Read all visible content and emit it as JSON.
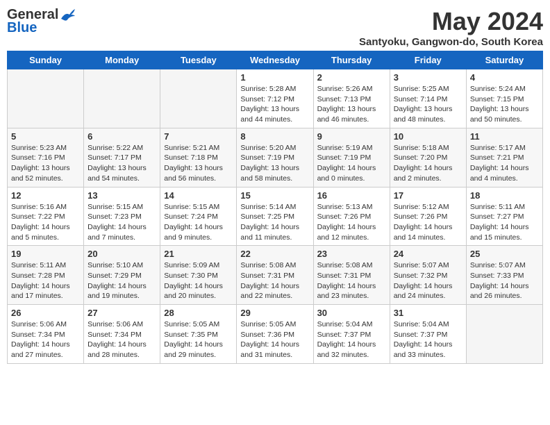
{
  "header": {
    "logo_general": "General",
    "logo_blue": "Blue",
    "month_year": "May 2024",
    "location": "Santyoku, Gangwon-do, South Korea"
  },
  "days_of_week": [
    "Sunday",
    "Monday",
    "Tuesday",
    "Wednesday",
    "Thursday",
    "Friday",
    "Saturday"
  ],
  "weeks": [
    [
      {
        "day": "",
        "empty": true
      },
      {
        "day": "",
        "empty": true
      },
      {
        "day": "",
        "empty": true
      },
      {
        "day": "1",
        "sunrise": "5:28 AM",
        "sunset": "7:12 PM",
        "daylight": "13 hours and 44 minutes."
      },
      {
        "day": "2",
        "sunrise": "5:26 AM",
        "sunset": "7:13 PM",
        "daylight": "13 hours and 46 minutes."
      },
      {
        "day": "3",
        "sunrise": "5:25 AM",
        "sunset": "7:14 PM",
        "daylight": "13 hours and 48 minutes."
      },
      {
        "day": "4",
        "sunrise": "5:24 AM",
        "sunset": "7:15 PM",
        "daylight": "13 hours and 50 minutes."
      }
    ],
    [
      {
        "day": "5",
        "sunrise": "5:23 AM",
        "sunset": "7:16 PM",
        "daylight": "13 hours and 52 minutes."
      },
      {
        "day": "6",
        "sunrise": "5:22 AM",
        "sunset": "7:17 PM",
        "daylight": "13 hours and 54 minutes."
      },
      {
        "day": "7",
        "sunrise": "5:21 AM",
        "sunset": "7:18 PM",
        "daylight": "13 hours and 56 minutes."
      },
      {
        "day": "8",
        "sunrise": "5:20 AM",
        "sunset": "7:19 PM",
        "daylight": "13 hours and 58 minutes."
      },
      {
        "day": "9",
        "sunrise": "5:19 AM",
        "sunset": "7:19 PM",
        "daylight": "14 hours and 0 minutes."
      },
      {
        "day": "10",
        "sunrise": "5:18 AM",
        "sunset": "7:20 PM",
        "daylight": "14 hours and 2 minutes."
      },
      {
        "day": "11",
        "sunrise": "5:17 AM",
        "sunset": "7:21 PM",
        "daylight": "14 hours and 4 minutes."
      }
    ],
    [
      {
        "day": "12",
        "sunrise": "5:16 AM",
        "sunset": "7:22 PM",
        "daylight": "14 hours and 5 minutes."
      },
      {
        "day": "13",
        "sunrise": "5:15 AM",
        "sunset": "7:23 PM",
        "daylight": "14 hours and 7 minutes."
      },
      {
        "day": "14",
        "sunrise": "5:15 AM",
        "sunset": "7:24 PM",
        "daylight": "14 hours and 9 minutes."
      },
      {
        "day": "15",
        "sunrise": "5:14 AM",
        "sunset": "7:25 PM",
        "daylight": "14 hours and 11 minutes."
      },
      {
        "day": "16",
        "sunrise": "5:13 AM",
        "sunset": "7:26 PM",
        "daylight": "14 hours and 12 minutes."
      },
      {
        "day": "17",
        "sunrise": "5:12 AM",
        "sunset": "7:26 PM",
        "daylight": "14 hours and 14 minutes."
      },
      {
        "day": "18",
        "sunrise": "5:11 AM",
        "sunset": "7:27 PM",
        "daylight": "14 hours and 15 minutes."
      }
    ],
    [
      {
        "day": "19",
        "sunrise": "5:11 AM",
        "sunset": "7:28 PM",
        "daylight": "14 hours and 17 minutes."
      },
      {
        "day": "20",
        "sunrise": "5:10 AM",
        "sunset": "7:29 PM",
        "daylight": "14 hours and 19 minutes."
      },
      {
        "day": "21",
        "sunrise": "5:09 AM",
        "sunset": "7:30 PM",
        "daylight": "14 hours and 20 minutes."
      },
      {
        "day": "22",
        "sunrise": "5:08 AM",
        "sunset": "7:31 PM",
        "daylight": "14 hours and 22 minutes."
      },
      {
        "day": "23",
        "sunrise": "5:08 AM",
        "sunset": "7:31 PM",
        "daylight": "14 hours and 23 minutes."
      },
      {
        "day": "24",
        "sunrise": "5:07 AM",
        "sunset": "7:32 PM",
        "daylight": "14 hours and 24 minutes."
      },
      {
        "day": "25",
        "sunrise": "5:07 AM",
        "sunset": "7:33 PM",
        "daylight": "14 hours and 26 minutes."
      }
    ],
    [
      {
        "day": "26",
        "sunrise": "5:06 AM",
        "sunset": "7:34 PM",
        "daylight": "14 hours and 27 minutes."
      },
      {
        "day": "27",
        "sunrise": "5:06 AM",
        "sunset": "7:34 PM",
        "daylight": "14 hours and 28 minutes."
      },
      {
        "day": "28",
        "sunrise": "5:05 AM",
        "sunset": "7:35 PM",
        "daylight": "14 hours and 29 minutes."
      },
      {
        "day": "29",
        "sunrise": "5:05 AM",
        "sunset": "7:36 PM",
        "daylight": "14 hours and 31 minutes."
      },
      {
        "day": "30",
        "sunrise": "5:04 AM",
        "sunset": "7:37 PM",
        "daylight": "14 hours and 32 minutes."
      },
      {
        "day": "31",
        "sunrise": "5:04 AM",
        "sunset": "7:37 PM",
        "daylight": "14 hours and 33 minutes."
      },
      {
        "day": "",
        "empty": true
      }
    ]
  ]
}
